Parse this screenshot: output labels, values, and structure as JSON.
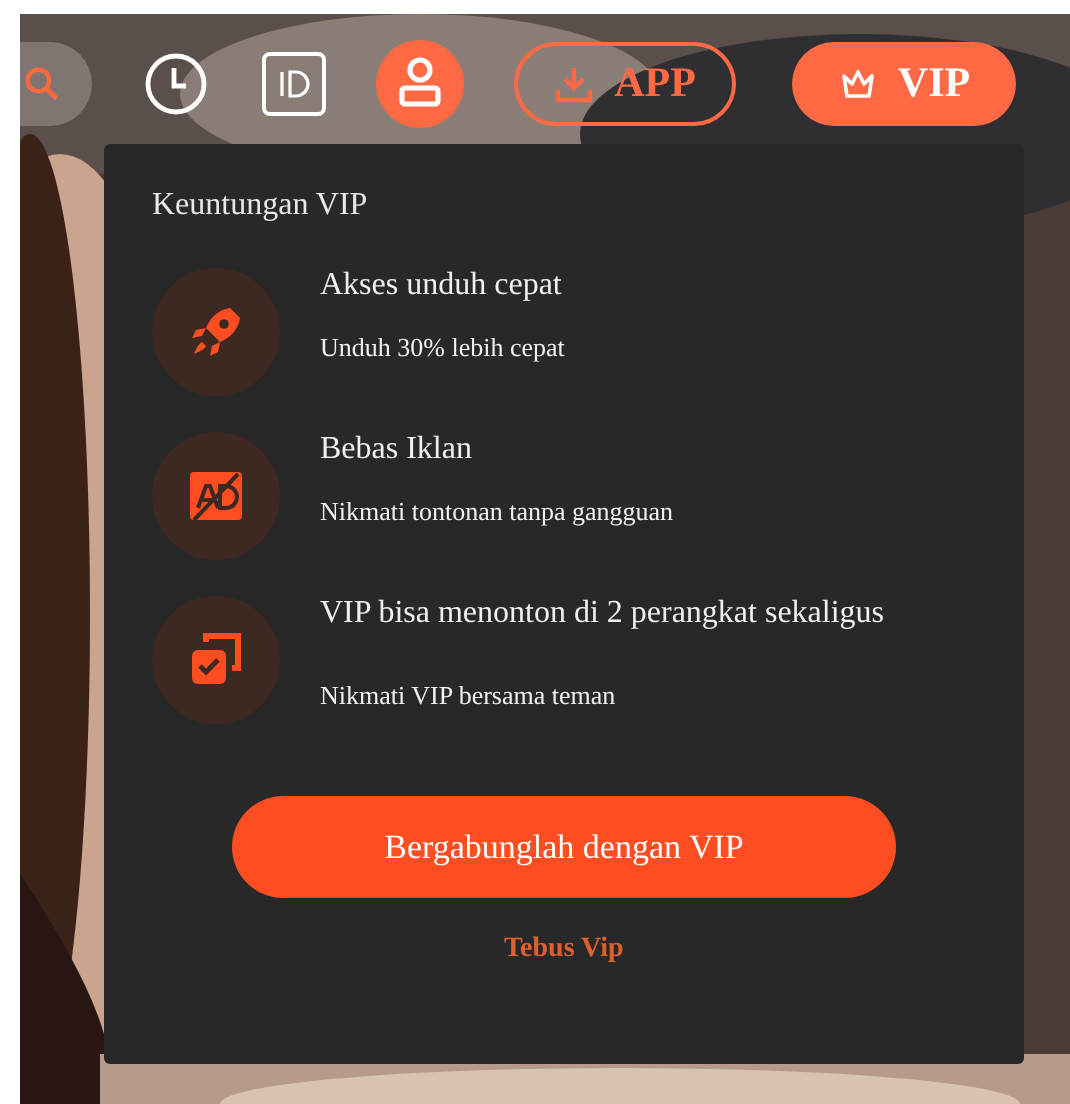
{
  "header": {
    "buttons": [
      {
        "kind": "download",
        "label": "APP"
      },
      {
        "kind": "vip",
        "label": "VIP"
      }
    ]
  },
  "panel": {
    "title": "Keuntungan VIP",
    "benefits": [
      {
        "kind": "speed",
        "title": "Akses unduh cepat",
        "subtitle": "Unduh 30% lebih cepat"
      },
      {
        "kind": "noads",
        "title": "Bebas Iklan",
        "subtitle": "Nikmati tontonan tanpa gangguan"
      },
      {
        "kind": "devices",
        "title": "VIP bisa menonton di 2 perangkat sekaligus",
        "subtitle": "Nikmati VIP bersama teman"
      }
    ],
    "join_button": "Bergabunglah dengan VIP",
    "redeem_link": "Tebus Vip"
  }
}
